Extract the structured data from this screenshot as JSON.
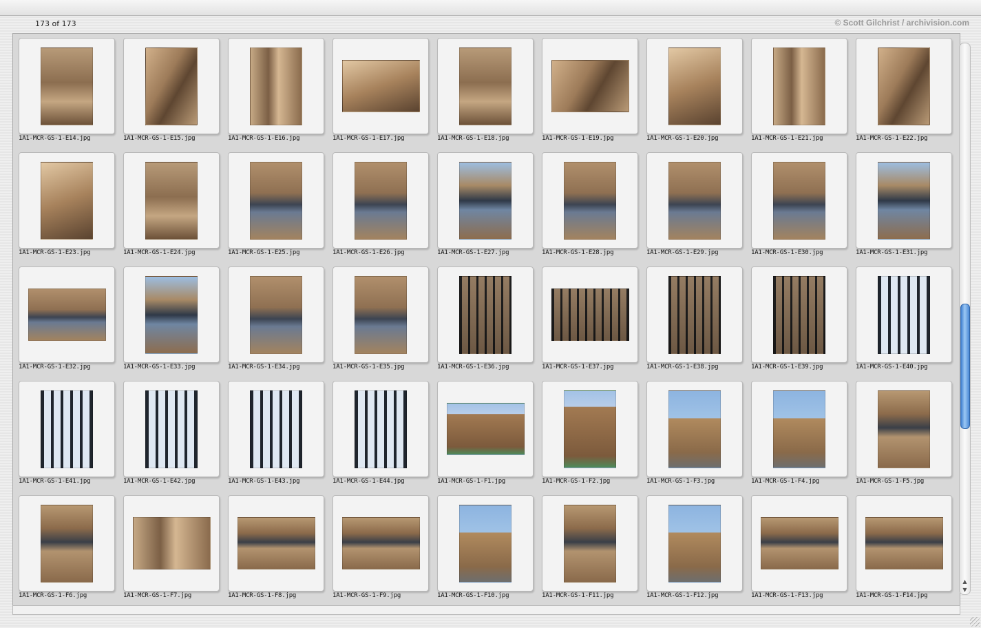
{
  "header": {
    "count_label": "173 of 173",
    "credit": "© Scott Gilchrist / archivision.com"
  },
  "thumbnails": [
    {
      "file": "1A1-MCR-GS-1-E14.jpg",
      "orientation": "portrait",
      "style": "s1"
    },
    {
      "file": "1A1-MCR-GS-1-E15.jpg",
      "orientation": "portrait",
      "style": "s2"
    },
    {
      "file": "1A1-MCR-GS-1-E16.jpg",
      "orientation": "portrait",
      "style": "s3"
    },
    {
      "file": "1A1-MCR-GS-1-E17.jpg",
      "orientation": "landscape",
      "style": "s4"
    },
    {
      "file": "1A1-MCR-GS-1-E18.jpg",
      "orientation": "portrait",
      "style": "s1"
    },
    {
      "file": "1A1-MCR-GS-1-E19.jpg",
      "orientation": "landscape",
      "style": "s2"
    },
    {
      "file": "1A1-MCR-GS-1-E20.jpg",
      "orientation": "portrait",
      "style": "s4"
    },
    {
      "file": "1A1-MCR-GS-1-E21.jpg",
      "orientation": "portrait",
      "style": "s3"
    },
    {
      "file": "1A1-MCR-GS-1-E22.jpg",
      "orientation": "portrait",
      "style": "s2"
    },
    {
      "file": "1A1-MCR-GS-1-E23.jpg",
      "orientation": "portrait",
      "style": "s4"
    },
    {
      "file": "1A1-MCR-GS-1-E24.jpg",
      "orientation": "portrait",
      "style": "s1"
    },
    {
      "file": "1A1-MCR-GS-1-E25.jpg",
      "orientation": "portrait",
      "style": "w1"
    },
    {
      "file": "1A1-MCR-GS-1-E26.jpg",
      "orientation": "portrait",
      "style": "w1"
    },
    {
      "file": "1A1-MCR-GS-1-E27.jpg",
      "orientation": "portrait",
      "style": "w2"
    },
    {
      "file": "1A1-MCR-GS-1-E28.jpg",
      "orientation": "portrait",
      "style": "w1"
    },
    {
      "file": "1A1-MCR-GS-1-E29.jpg",
      "orientation": "portrait",
      "style": "w1"
    },
    {
      "file": "1A1-MCR-GS-1-E30.jpg",
      "orientation": "portrait",
      "style": "w1"
    },
    {
      "file": "1A1-MCR-GS-1-E31.jpg",
      "orientation": "portrait",
      "style": "w2"
    },
    {
      "file": "1A1-MCR-GS-1-E32.jpg",
      "orientation": "landscape",
      "style": "w1"
    },
    {
      "file": "1A1-MCR-GS-1-E33.jpg",
      "orientation": "portrait",
      "style": "w2"
    },
    {
      "file": "1A1-MCR-GS-1-E34.jpg",
      "orientation": "portrait",
      "style": "w1"
    },
    {
      "file": "1A1-MCR-GS-1-E35.jpg",
      "orientation": "portrait",
      "style": "w1"
    },
    {
      "file": "1A1-MCR-GS-1-E36.jpg",
      "orientation": "portrait",
      "style": "g1"
    },
    {
      "file": "1A1-MCR-GS-1-E37.jpg",
      "orientation": "landscape",
      "style": "g1"
    },
    {
      "file": "1A1-MCR-GS-1-E38.jpg",
      "orientation": "portrait",
      "style": "g1"
    },
    {
      "file": "1A1-MCR-GS-1-E39.jpg",
      "orientation": "portrait",
      "style": "g1"
    },
    {
      "file": "1A1-MCR-GS-1-E40.jpg",
      "orientation": "portrait",
      "style": "g2"
    },
    {
      "file": "1A1-MCR-GS-1-E41.jpg",
      "orientation": "portrait",
      "style": "g2"
    },
    {
      "file": "1A1-MCR-GS-1-E42.jpg",
      "orientation": "portrait",
      "style": "g2"
    },
    {
      "file": "1A1-MCR-GS-1-E43.jpg",
      "orientation": "portrait",
      "style": "g2"
    },
    {
      "file": "1A1-MCR-GS-1-E44.jpg",
      "orientation": "portrait",
      "style": "g2"
    },
    {
      "file": "1A1-MCR-GS-1-F1.jpg",
      "orientation": "landscape",
      "style": "b2"
    },
    {
      "file": "1A1-MCR-GS-1-F2.jpg",
      "orientation": "portrait",
      "style": "b2"
    },
    {
      "file": "1A1-MCR-GS-1-F3.jpg",
      "orientation": "portrait",
      "style": "b1"
    },
    {
      "file": "1A1-MCR-GS-1-F4.jpg",
      "orientation": "portrait",
      "style": "b1"
    },
    {
      "file": "1A1-MCR-GS-1-F5.jpg",
      "orientation": "portrait",
      "style": "f1"
    },
    {
      "file": "1A1-MCR-GS-1-F6.jpg",
      "orientation": "portrait",
      "style": "f1"
    },
    {
      "file": "1A1-MCR-GS-1-F7.jpg",
      "orientation": "landscape",
      "style": "s3"
    },
    {
      "file": "1A1-MCR-GS-1-F8.jpg",
      "orientation": "landscape",
      "style": "f1"
    },
    {
      "file": "1A1-MCR-GS-1-F9.jpg",
      "orientation": "landscape",
      "style": "f1"
    },
    {
      "file": "1A1-MCR-GS-1-F10.jpg",
      "orientation": "portrait",
      "style": "b1"
    },
    {
      "file": "1A1-MCR-GS-1-F11.jpg",
      "orientation": "portrait",
      "style": "f1"
    },
    {
      "file": "1A1-MCR-GS-1-F12.jpg",
      "orientation": "portrait",
      "style": "b1"
    },
    {
      "file": "1A1-MCR-GS-1-F13.jpg",
      "orientation": "landscape",
      "style": "f1"
    },
    {
      "file": "1A1-MCR-GS-1-F14.jpg",
      "orientation": "landscape",
      "style": "f1"
    }
  ]
}
